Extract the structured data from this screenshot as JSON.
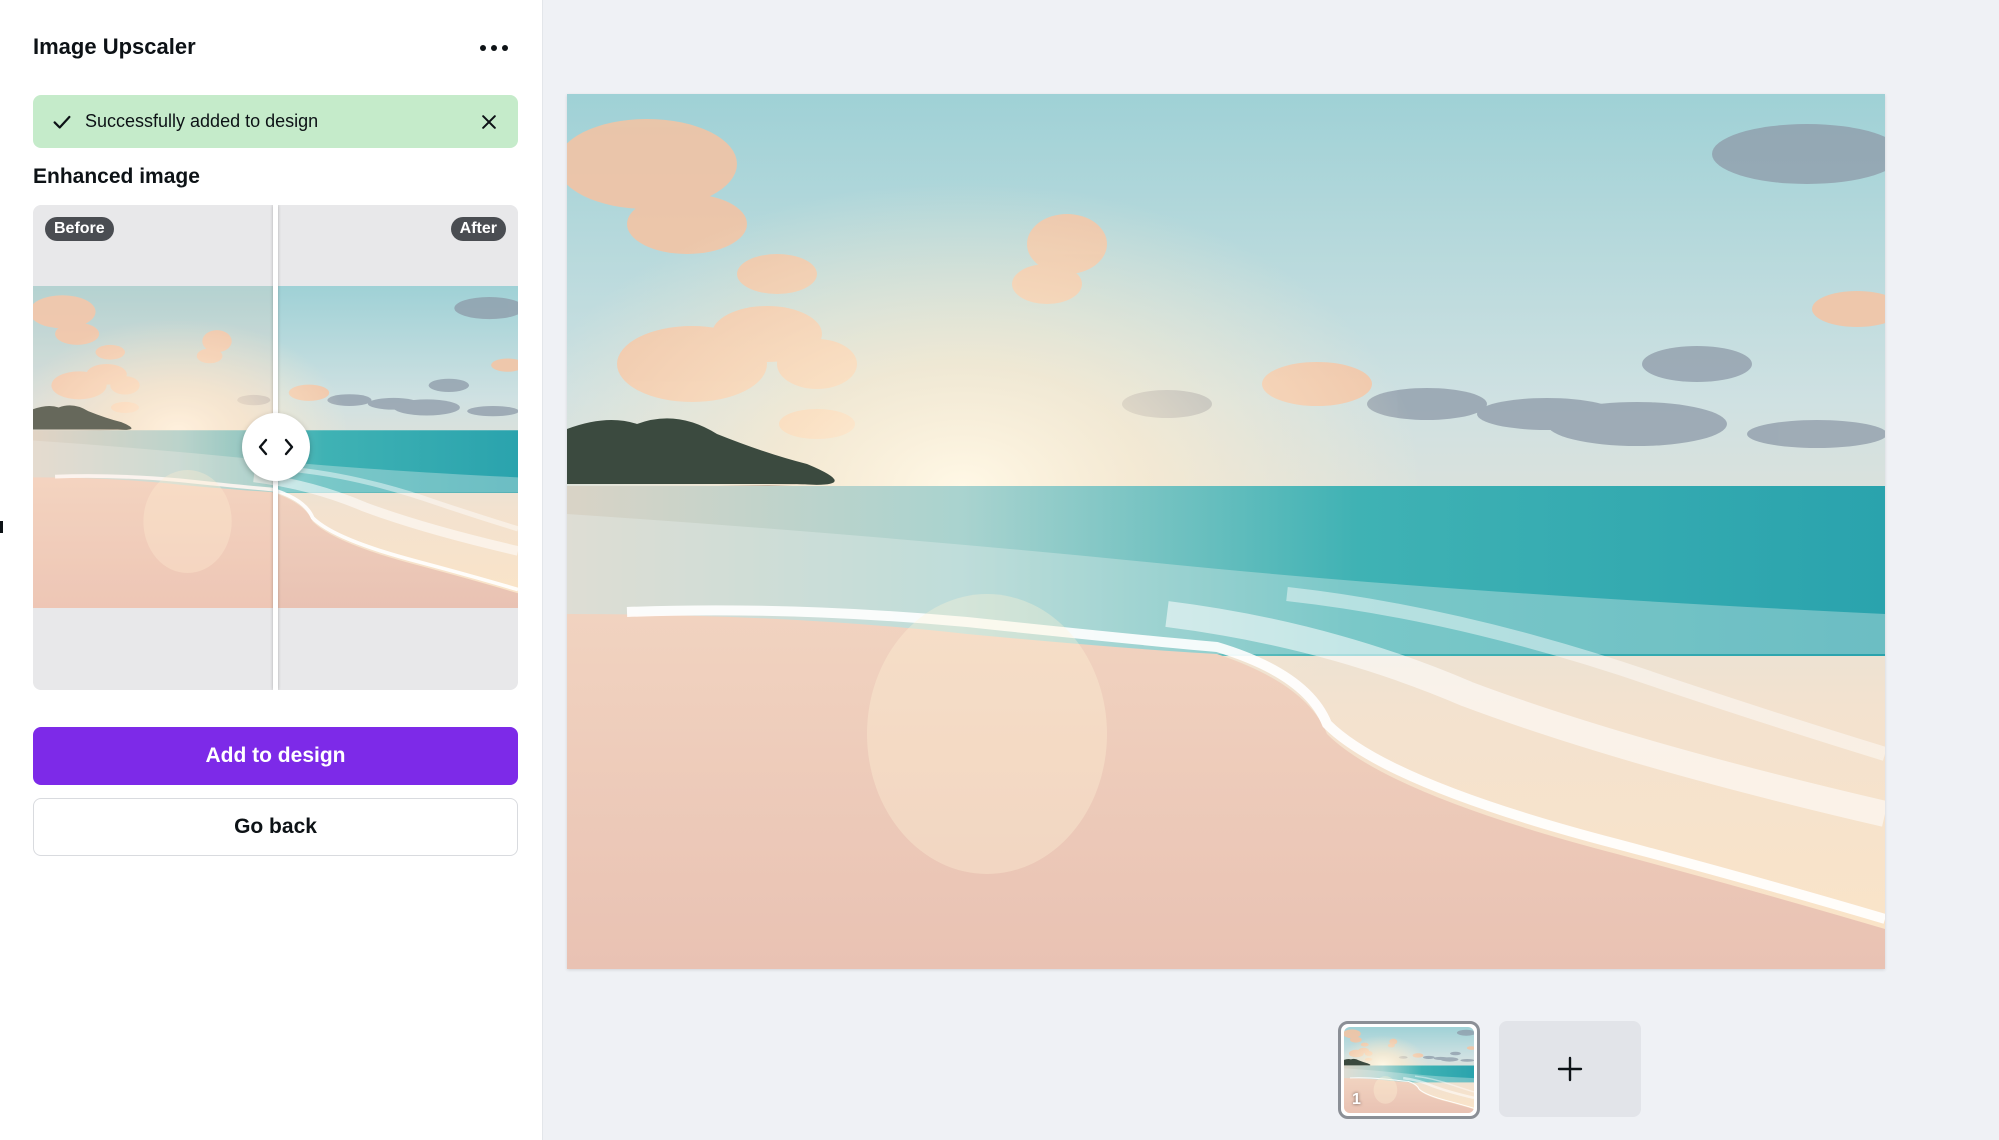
{
  "panel": {
    "title": "Image Upscaler",
    "more_icon": "more-horizontal-icon"
  },
  "toast": {
    "message": "Successfully added to design",
    "status_icon": "check-icon",
    "close_icon": "close-icon",
    "color": "#c5ebca"
  },
  "compare": {
    "section_title": "Enhanced image",
    "before_label": "Before",
    "after_label": "After",
    "handle_icon": "chevron-left-right-icon"
  },
  "actions": {
    "primary_label": "Add to design",
    "secondary_label": "Go back",
    "primary_color": "#7d2ae8"
  },
  "pages": {
    "items": [
      {
        "number": "1",
        "selected": true
      }
    ],
    "add_icon": "plus-icon"
  }
}
